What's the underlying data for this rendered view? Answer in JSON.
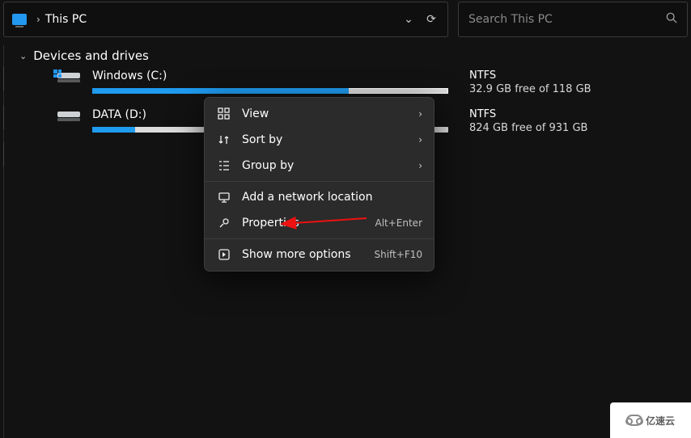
{
  "address_bar": {
    "location": "This PC"
  },
  "search": {
    "placeholder": "Search This PC"
  },
  "group": {
    "title": "Devices and drives"
  },
  "drives": [
    {
      "name": "Windows (C:)",
      "fs": "NTFS",
      "free": "32.9 GB free of 118 GB",
      "fill_pct": 72
    },
    {
      "name": "DATA (D:)",
      "fs": "NTFS",
      "free": "824 GB free of 931 GB",
      "fill_pct": 12
    }
  ],
  "context_menu": {
    "items": [
      {
        "icon": "view-icon",
        "label": "View",
        "submenu": true
      },
      {
        "icon": "sort-icon",
        "label": "Sort by",
        "submenu": true
      },
      {
        "icon": "group-icon",
        "label": "Group by",
        "submenu": true
      },
      {
        "sep": true
      },
      {
        "icon": "network-icon",
        "label": "Add a network location"
      },
      {
        "icon": "properties-icon",
        "label": "Properties",
        "shortcut": "Alt+Enter"
      },
      {
        "sep": true
      },
      {
        "icon": "more-icon",
        "label": "Show more options",
        "shortcut": "Shift+F10"
      }
    ]
  },
  "watermark": {
    "text": "亿速云"
  }
}
